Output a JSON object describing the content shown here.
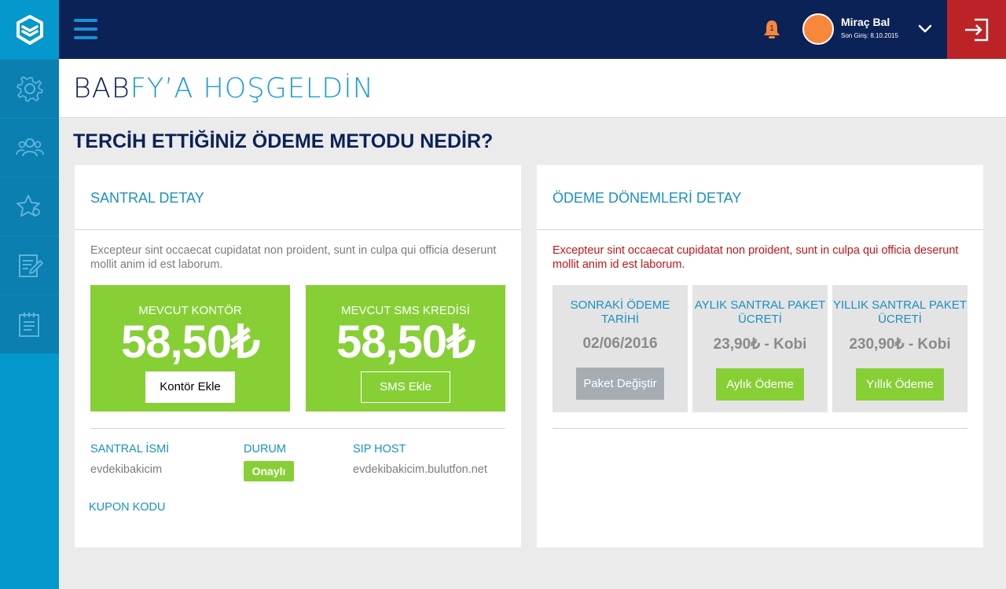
{
  "topbar": {
    "user_name": "Miraç Bal",
    "last_login": "Son Giriş: 8.10.2015",
    "notification_count": "1"
  },
  "sidebar": {
    "items": [
      {
        "icon": "gear-icon"
      },
      {
        "icon": "users-icon"
      },
      {
        "icon": "star-settings-icon"
      },
      {
        "icon": "edit-document-icon"
      },
      {
        "icon": "calendar-list-icon"
      }
    ]
  },
  "banner": {
    "title_part1": "BAB",
    "title_part2": "FY’A HOŞGELDİN"
  },
  "question": "TERCİH ETTİĞİNİZ ÖDEME METODU NEDİR?",
  "left_card": {
    "title": "SANTRAL DETAY",
    "description": "Excepteur sint occaecat cupidatat non proident, sunt in culpa qui officia deserunt mollit anim id est laborum.",
    "boxes": [
      {
        "label": "MEVCUT KONTÖR",
        "value": "58,50₺",
        "button": "Kontör Ekle"
      },
      {
        "label": "MEVCUT SMS KREDİSİ",
        "value": "58,50₺",
        "button": "SMS Ekle"
      }
    ],
    "info": {
      "santral_label": "SANTRAL İSMİ",
      "santral_value": "evdekibakicim",
      "status_label": "DURUM",
      "status_value": "Onaylı",
      "sip_label": "SIP HOST",
      "sip_value": "evdekibakicim.bulutfon.net",
      "coupon_label": "KUPON KODU"
    }
  },
  "right_card": {
    "title": "ÖDEME DÖNEMLERİ DETAY",
    "description": "Excepteur sint occaecat cupidatat non proident, sunt in culpa qui officia deserunt mollit anim id est laborum.",
    "boxes": [
      {
        "title": "SONRAKİ ÖDEME TARİHİ",
        "value": "02/06/2016",
        "button": "Paket Değiştir"
      },
      {
        "title": "AYLIK SANTRAL PAKET ÜCRETİ",
        "value": "23,90₺ - Kobi",
        "button": "Aylık Ödeme"
      },
      {
        "title": "YILLIK SANTRAL PAKET ÜCRETİ",
        "value": "230,90₺ - Kobi",
        "button": "Yıllık Ödeme"
      }
    ]
  },
  "colors": {
    "navy": "#0b2257",
    "blue": "#0598cc",
    "green": "#86cf35",
    "red": "#bb2327",
    "orange": "#f7873a"
  }
}
